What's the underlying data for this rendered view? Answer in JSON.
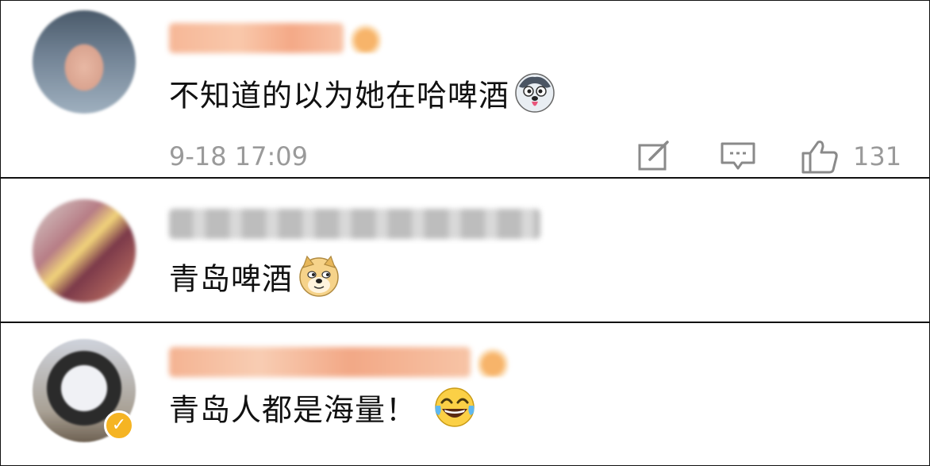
{
  "comments": [
    {
      "text": "不知道的以为她在哈啤酒",
      "emoji": "husky-emoji",
      "time": "9-18 17:09",
      "likes": "131",
      "crown": true,
      "vip_badge": false
    },
    {
      "text": "青岛啤酒",
      "emoji": "doge-emoji",
      "crown": false,
      "vip_badge": false
    },
    {
      "text": "青岛人都是海量！",
      "emoji": "laugh-cry-emoji",
      "crown": true,
      "vip_badge": true
    }
  ],
  "icons": {
    "edit": "edit-icon",
    "reply": "comment-icon",
    "like": "thumb-up-icon"
  },
  "colors": {
    "meta_gray": "#9a9a9a",
    "text": "#111111",
    "divider": "#111111",
    "badge_gold": "#f5b423"
  }
}
